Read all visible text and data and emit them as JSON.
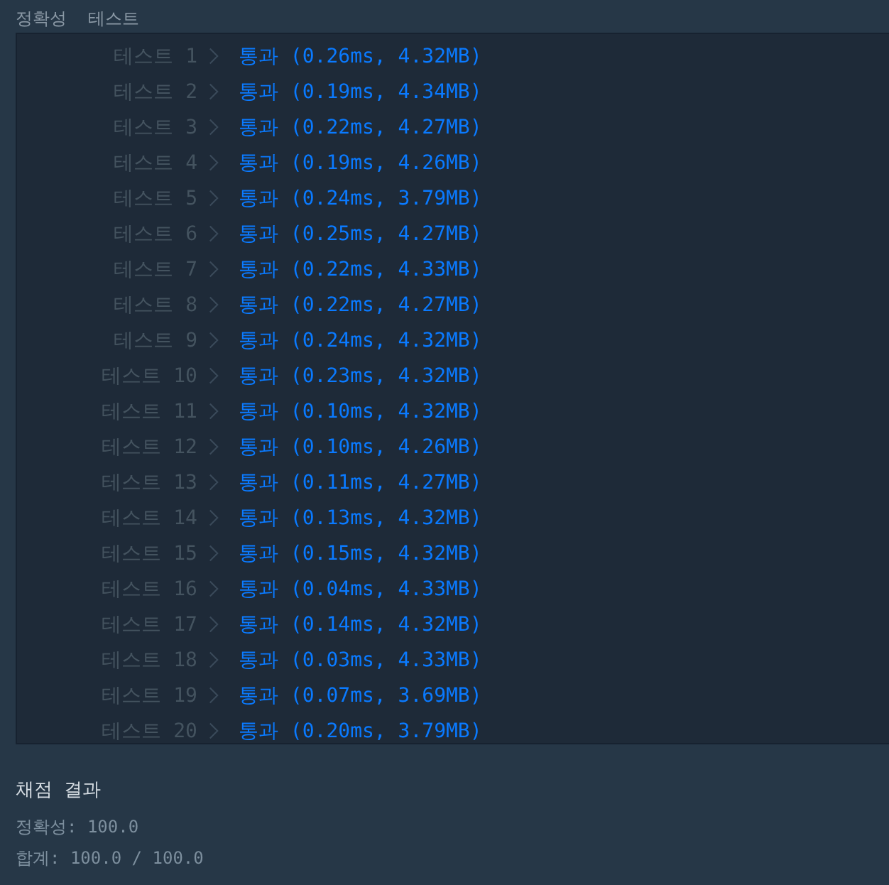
{
  "tabs": [
    "정확성",
    "테스트"
  ],
  "tests": [
    {
      "label": "테스트 1",
      "result": "통과 (0.26ms, 4.32MB)"
    },
    {
      "label": "테스트 2",
      "result": "통과 (0.19ms, 4.34MB)"
    },
    {
      "label": "테스트 3",
      "result": "통과 (0.22ms, 4.27MB)"
    },
    {
      "label": "테스트 4",
      "result": "통과 (0.19ms, 4.26MB)"
    },
    {
      "label": "테스트 5",
      "result": "통과 (0.24ms, 3.79MB)"
    },
    {
      "label": "테스트 6",
      "result": "통과 (0.25ms, 4.27MB)"
    },
    {
      "label": "테스트 7",
      "result": "통과 (0.22ms, 4.33MB)"
    },
    {
      "label": "테스트 8",
      "result": "통과 (0.22ms, 4.27MB)"
    },
    {
      "label": "테스트 9",
      "result": "통과 (0.24ms, 4.32MB)"
    },
    {
      "label": "테스트 10",
      "result": "통과 (0.23ms, 4.32MB)"
    },
    {
      "label": "테스트 11",
      "result": "통과 (0.10ms, 4.32MB)"
    },
    {
      "label": "테스트 12",
      "result": "통과 (0.10ms, 4.26MB)"
    },
    {
      "label": "테스트 13",
      "result": "통과 (0.11ms, 4.27MB)"
    },
    {
      "label": "테스트 14",
      "result": "통과 (0.13ms, 4.32MB)"
    },
    {
      "label": "테스트 15",
      "result": "통과 (0.15ms, 4.32MB)"
    },
    {
      "label": "테스트 16",
      "result": "통과 (0.04ms, 4.33MB)"
    },
    {
      "label": "테스트 17",
      "result": "통과 (0.14ms, 4.32MB)"
    },
    {
      "label": "테스트 18",
      "result": "통과 (0.03ms, 4.33MB)"
    },
    {
      "label": "테스트 19",
      "result": "통과 (0.07ms, 3.69MB)"
    },
    {
      "label": "테스트 20",
      "result": "통과 (0.20ms, 3.79MB)"
    }
  ],
  "summary": {
    "title": "채점 결과",
    "lines": [
      "정확성: 100.0",
      "합계: 100.0 / 100.0"
    ]
  }
}
